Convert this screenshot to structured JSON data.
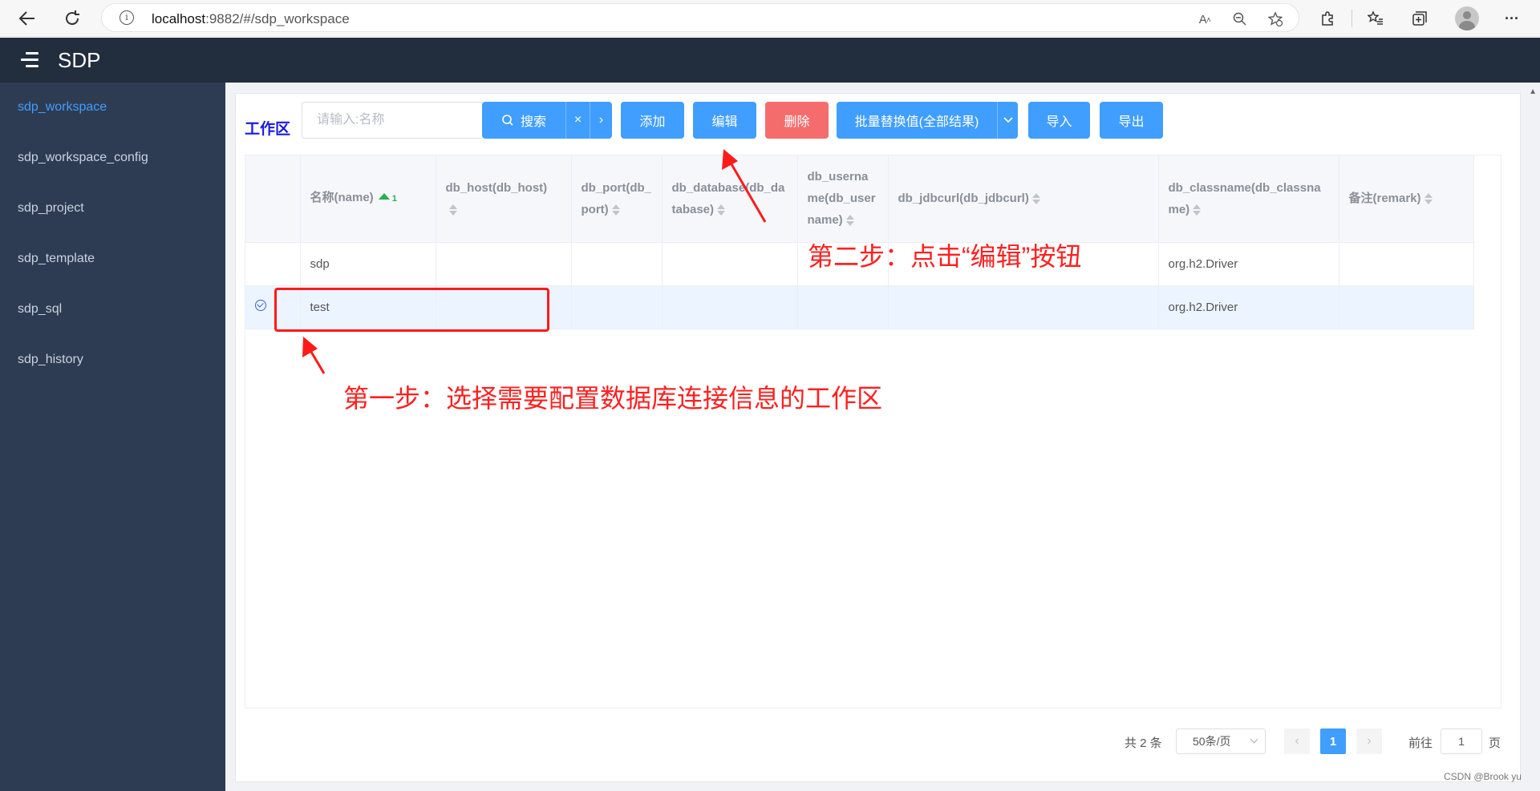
{
  "browser": {
    "url_host": "localhost",
    "url_rest": ":9882/#/sdp_workspace"
  },
  "app": {
    "title": "SDP"
  },
  "sidebar": {
    "items": [
      {
        "label": "sdp_workspace",
        "active": true
      },
      {
        "label": "sdp_workspace_config"
      },
      {
        "label": "sdp_project"
      },
      {
        "label": "sdp_template"
      },
      {
        "label": "sdp_sql"
      },
      {
        "label": "sdp_history"
      }
    ]
  },
  "toolbar": {
    "section_title": "工作区",
    "search_placeholder": "请输入:名称",
    "search_label": "搜索",
    "clear_label": "×",
    "next_label": "›",
    "add_label": "添加",
    "edit_label": "编辑",
    "delete_label": "删除",
    "batch_label": "批量替换值(全部结果)",
    "import_label": "导入",
    "export_label": "导出"
  },
  "table": {
    "columns": [
      {
        "key": "name",
        "label": "名称(name)",
        "sort_index": "1"
      },
      {
        "key": "db_host",
        "label": "db_host(db_host)"
      },
      {
        "key": "db_port",
        "label": "db_port(db_port)"
      },
      {
        "key": "db_database",
        "label": "db_database(db_database)"
      },
      {
        "key": "db_username",
        "label": "db_username(db_username)"
      },
      {
        "key": "db_jdbcurl",
        "label": "db_jdbcurl(db_jdbcurl)"
      },
      {
        "key": "db_classname",
        "label": "db_classname(db_classname)"
      },
      {
        "key": "remark",
        "label": "备注(remark)"
      }
    ],
    "rows": [
      {
        "name": "sdp",
        "db_host": "",
        "db_port": "",
        "db_database": "",
        "db_username": "",
        "db_jdbcurl": "",
        "db_classname": "org.h2.Driver",
        "remark": "",
        "selected": false
      },
      {
        "name": "test",
        "db_host": "",
        "db_port": "",
        "db_database": "",
        "db_username": "",
        "db_jdbcurl": "",
        "db_classname": "org.h2.Driver",
        "remark": "",
        "selected": true
      }
    ]
  },
  "pagination": {
    "total_text": "共 2 条",
    "page_size": "50条/页",
    "current_page": "1",
    "goto_label": "前往",
    "goto_value": "1",
    "page_suffix": "页"
  },
  "annotations": {
    "step1": "第一步：选择需要配置数据库连接信息的工作区",
    "step2": "第二步：点击“编辑”按钮",
    "color": "#ff2020"
  },
  "watermark": "CSDN @Brook yu",
  "colors": {
    "primary": "#409eff",
    "danger": "#f56c6c",
    "header_bg": "#222d3e",
    "sidebar_bg": "#2e3c53"
  }
}
